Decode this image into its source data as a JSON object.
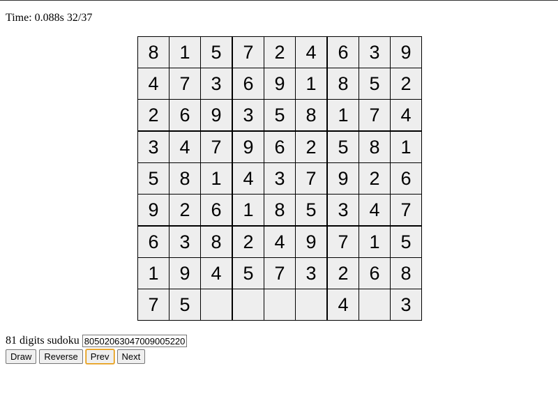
{
  "status": "Time: 0.088s 32/37",
  "grid": [
    [
      "8",
      "1",
      "5",
      "7",
      "2",
      "4",
      "6",
      "3",
      "9"
    ],
    [
      "4",
      "7",
      "3",
      "6",
      "9",
      "1",
      "8",
      "5",
      "2"
    ],
    [
      "2",
      "6",
      "9",
      "3",
      "5",
      "8",
      "1",
      "7",
      "4"
    ],
    [
      "3",
      "4",
      "7",
      "9",
      "6",
      "2",
      "5",
      "8",
      "1"
    ],
    [
      "5",
      "8",
      "1",
      "4",
      "3",
      "7",
      "9",
      "2",
      "6"
    ],
    [
      "9",
      "2",
      "6",
      "1",
      "8",
      "5",
      "3",
      "4",
      "7"
    ],
    [
      "6",
      "3",
      "8",
      "2",
      "4",
      "9",
      "7",
      "1",
      "5"
    ],
    [
      "1",
      "9",
      "4",
      "5",
      "7",
      "3",
      "2",
      "6",
      "8"
    ],
    [
      "7",
      "5",
      "",
      "",
      "",
      "",
      "4",
      "",
      "3"
    ]
  ],
  "controls": {
    "label": "81 digits sudoku",
    "input_value": "80502063047009005220",
    "buttons": [
      "Draw",
      "Reverse",
      "Prev",
      "Next"
    ]
  }
}
